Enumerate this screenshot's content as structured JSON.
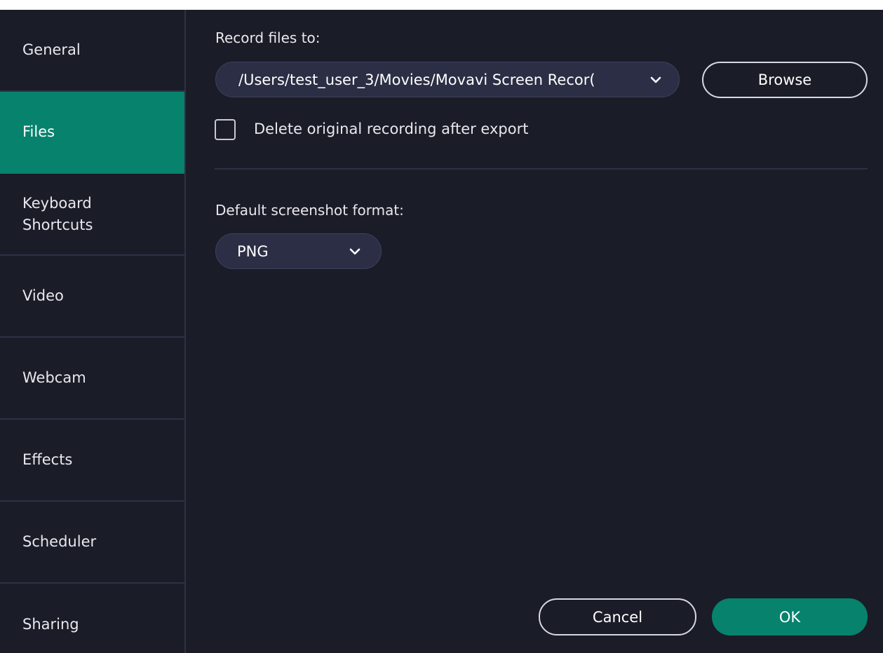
{
  "sidebar": {
    "items": [
      {
        "label": "General"
      },
      {
        "label": "Files"
      },
      {
        "label": "Keyboard\nShortcuts"
      },
      {
        "label": "Video"
      },
      {
        "label": "Webcam"
      },
      {
        "label": "Effects"
      },
      {
        "label": "Scheduler"
      },
      {
        "label": "Sharing"
      }
    ],
    "active": "Files"
  },
  "files": {
    "record_label": "Record files to:",
    "record_path": "/Users/test_user_3/Movies/Movavi Screen Recor(",
    "browse_label": "Browse",
    "delete_checkbox_label": "Delete original recording after export",
    "delete_checked": false,
    "screenshot_format_label": "Default screenshot format:",
    "screenshot_format_value": "PNG"
  },
  "footer": {
    "cancel_label": "Cancel",
    "ok_label": "OK"
  },
  "colors": {
    "background": "#1a1c27",
    "accent": "#06826d",
    "select_bg": "#2b2e44"
  },
  "icons": {
    "dropdown": "chevron-down-icon"
  }
}
